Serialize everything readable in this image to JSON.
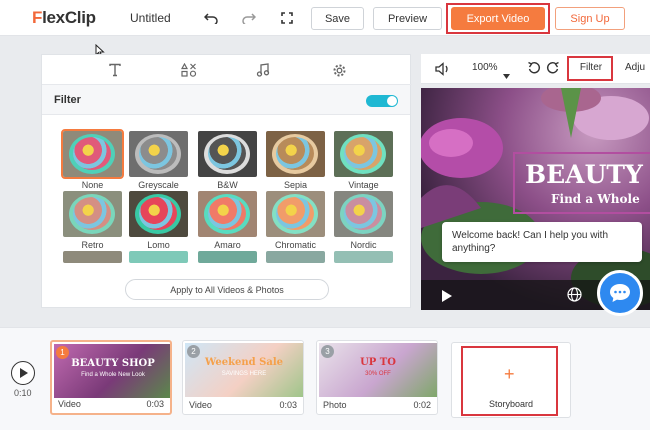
{
  "header": {
    "logo_text": "lexClip",
    "logo_initial": "F",
    "doc_title": "Untitled",
    "save_label": "Save",
    "preview_label": "Preview",
    "export_label": "Export Video",
    "signup_label": "Sign Up"
  },
  "panel": {
    "filter_label": "Filter",
    "filter_enabled": true,
    "filters": [
      {
        "label": "None",
        "selected": true
      },
      {
        "label": "Greyscale",
        "selected": false
      },
      {
        "label": "B&W",
        "selected": false
      },
      {
        "label": "Sepia",
        "selected": false
      },
      {
        "label": "Vintage",
        "selected": false
      },
      {
        "label": "Retro",
        "selected": false
      },
      {
        "label": "Lomo",
        "selected": false
      },
      {
        "label": "Amaro",
        "selected": false
      },
      {
        "label": "Chromatic",
        "selected": false
      },
      {
        "label": "Nordic",
        "selected": false
      }
    ],
    "apply_all_label": "Apply to All Videos & Photos"
  },
  "preview": {
    "zoom": "100%",
    "filter_tab": "Filter",
    "adjust_tab": "Adju",
    "title_line1": "BEAUTY",
    "title_line2": "Find a Whole",
    "chat_message": "Welcome back! Can I help you with anything?"
  },
  "timeline": {
    "time": "0:10",
    "clips": [
      {
        "num": "1",
        "type": "Video",
        "duration": "0:03",
        "caption": "BEAUTY SHOP",
        "sub": "Find a Whole New Look",
        "active": true
      },
      {
        "num": "2",
        "type": "Video",
        "duration": "0:03",
        "caption": "Weekend Sale",
        "sub": "SAVINGS HERE",
        "active": false
      },
      {
        "num": "3",
        "type": "Photo",
        "duration": "0:02",
        "caption": "UP TO",
        "sub": "30% OFF",
        "active": false
      }
    ],
    "storyboard_label": "Storyboard"
  },
  "colors": {
    "accent": "#f57b3f",
    "highlight": "#d9363e",
    "toggle": "#1fb8d3",
    "chat": "#2e89f0"
  }
}
